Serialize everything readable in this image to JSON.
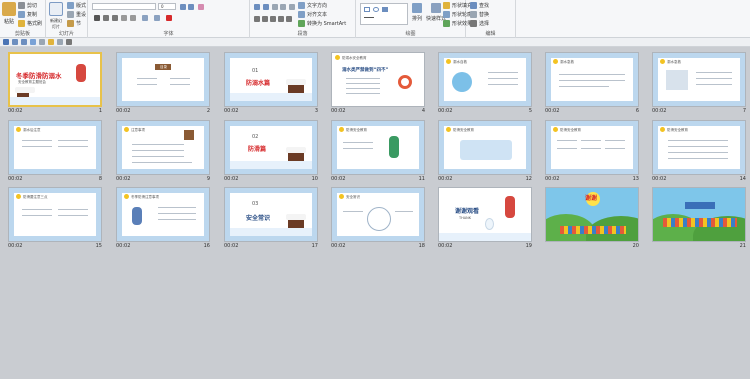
{
  "ribbon": {
    "clipboard": {
      "group_label": "剪贴板",
      "paste_label": "粘贴",
      "cut": "剪切",
      "copy": "复制",
      "format_painter": "格式刷"
    },
    "slides": {
      "group_label": "幻灯片",
      "new_slide": "新建幻灯片",
      "layout": "版式",
      "reset": "重设",
      "section": "节"
    },
    "font": {
      "group_label": "字体",
      "size_value": "0"
    },
    "paragraph": {
      "group_label": "段落",
      "text_direction": "文字方向",
      "align_text": "对齐文本",
      "convert_smartart": "转换为 SmartArt"
    },
    "drawing": {
      "group_label": "绘图",
      "arrange": "排列",
      "quick_styles": "快速样式",
      "shape_fill": "形状填充",
      "shape_outline": "形状轮廓",
      "shape_effects": "形状效果"
    },
    "editing": {
      "group_label": "编辑",
      "find": "查找",
      "replace": "替换",
      "select": "选择"
    }
  },
  "slides": [
    {
      "number": "1",
      "time": "00:02",
      "title": "冬季防滑防溺水",
      "subtitle": "安全教育主题班会"
    },
    {
      "number": "2",
      "time": "00:02",
      "title": "目录"
    },
    {
      "number": "3",
      "time": "00:02",
      "index": "01",
      "title": "防溺水篇"
    },
    {
      "number": "4",
      "time": "00:02",
      "title": "防溺水安全教育",
      "heading": "溺水类严禁做到“四不”"
    },
    {
      "number": "5",
      "time": "00:02",
      "title": "溺水自救"
    },
    {
      "number": "6",
      "time": "00:02",
      "title": "溺水急救"
    },
    {
      "number": "7",
      "time": "00:02",
      "title": "溺水急救"
    },
    {
      "number": "8",
      "time": "00:02",
      "title": "溺水后注意"
    },
    {
      "number": "9",
      "time": "00:02",
      "title": "注意事项"
    },
    {
      "number": "10",
      "time": "00:02",
      "index": "02",
      "title": "防滑篇"
    },
    {
      "number": "11",
      "time": "00:02",
      "title": "防滑安全教育"
    },
    {
      "number": "12",
      "time": "00:02",
      "title": "防滑安全教育"
    },
    {
      "number": "13",
      "time": "00:02",
      "title": "防滑安全教育"
    },
    {
      "number": "14",
      "time": "00:02",
      "title": "防滑安全教育"
    },
    {
      "number": "15",
      "time": "00:02",
      "title": "防滑要注意三点"
    },
    {
      "number": "16",
      "time": "00:02",
      "title": "冬季防滑注意事项"
    },
    {
      "number": "17",
      "time": "00:02",
      "index": "03",
      "title": "安全常识"
    },
    {
      "number": "18",
      "time": "00:02",
      "title": "安全常识"
    },
    {
      "number": "19",
      "time": "00:02",
      "title": "谢谢观看",
      "subtitle": "THANK"
    },
    {
      "number": "20",
      "time": "",
      "title": "谢谢"
    },
    {
      "number": "21",
      "time": "",
      "title": ""
    }
  ],
  "colors": {
    "accent": "#2f6fbf",
    "selected": "#e8c24a",
    "red": "#d6292b"
  }
}
